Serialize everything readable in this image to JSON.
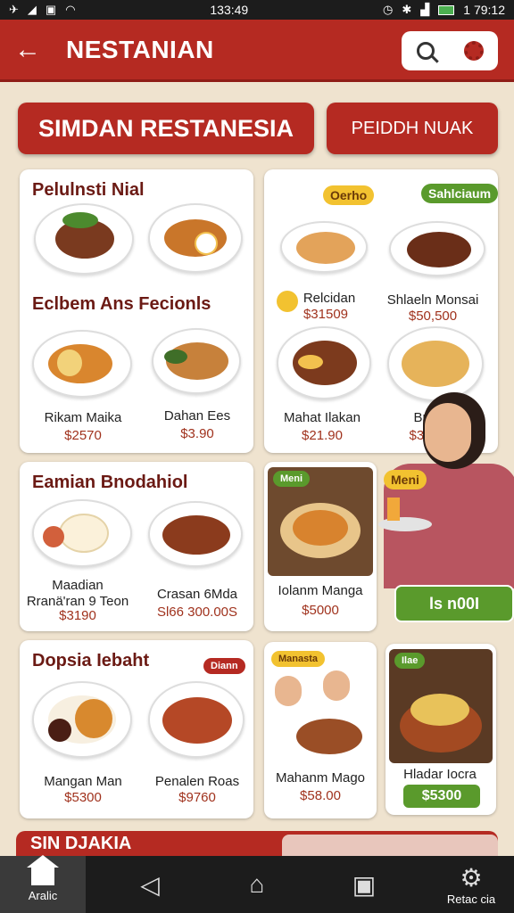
{
  "status_bar": {
    "time": "133:49",
    "right_time": "1 79:12"
  },
  "app_bar": {
    "title": "NESTANIAN"
  },
  "banner": {
    "main": "SIMDAN RESTANESIA",
    "side": "PEIDDH NUAK"
  },
  "sections": {
    "s1": {
      "title": "Pelulnsti Nial"
    },
    "s2": {
      "title": "Eclbem Ans Fecionls"
    },
    "s3": {
      "title": "Eamian Bnodahiol"
    },
    "s4": {
      "title": "Dopsia Iebaht"
    }
  },
  "dishes": {
    "d1": {
      "name": "Rikam Maika",
      "price": "$2570"
    },
    "d2": {
      "name": "Dahan Ees",
      "price": "$3.90"
    },
    "d3": {
      "name": "Relcidan",
      "price": "$31509"
    },
    "d4": {
      "name": "Shlaeln Monsai",
      "price": "$50,500"
    },
    "d5": {
      "name": "Mahat Ilakan",
      "price": "$21.90"
    },
    "d6": {
      "name": "Br",
      "price": "$30"
    },
    "d7": {
      "name": "Maadian\nRranä'ran 9 Teon",
      "price": "$3190"
    },
    "d8": {
      "name": "Crasan 6Mda",
      "price": "Sl66 300.00S"
    },
    "d9": {
      "name": "Iolanm Manga",
      "price": "$5000"
    },
    "d10": {
      "name": "Mangan Man",
      "price": "$5300"
    },
    "d11": {
      "name": "Penalen Roas",
      "price": "$9760"
    },
    "d12": {
      "name": "Mahanm Mago",
      "price": "$58.00"
    },
    "d13": {
      "name": "Hladar Iocra",
      "price": "$5300"
    }
  },
  "tags": {
    "t1": "Oerho",
    "t2": "Sahlciaum",
    "t3": "Meni",
    "t4": "Manasta",
    "t5": "Ilae",
    "t6": "Meni",
    "t7": "Diann"
  },
  "promo": {
    "price_button": "ls n00I"
  },
  "bottom": {
    "strip_label": "SIN DJAKIA"
  },
  "nav": {
    "home_label": "Aralic",
    "settings_label": "Retac cia"
  },
  "colors": {
    "brand_red": "#b52a22",
    "accent_green": "#5a9a2c"
  }
}
